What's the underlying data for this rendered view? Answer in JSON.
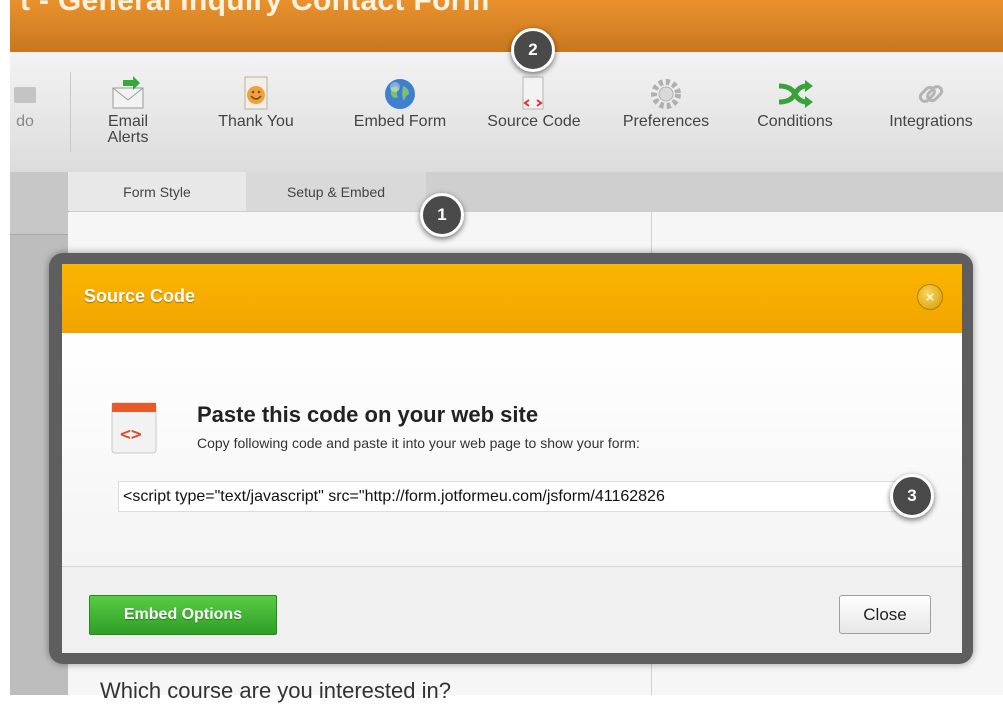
{
  "window": {
    "title": "t - General Inquiry Contact Form"
  },
  "toolbar": {
    "undo_label": "do",
    "items": [
      {
        "label": "Email",
        "label2": "Alerts",
        "icon": "envelope-icon"
      },
      {
        "label": "Thank You",
        "icon": "smiley-page-icon"
      },
      {
        "label": "Embed Form",
        "icon": "globe-icon"
      },
      {
        "label": "Source Code",
        "icon": "code-document-icon"
      },
      {
        "label": "Preferences",
        "icon": "gear-icon"
      },
      {
        "label": "Conditions",
        "icon": "shuffle-arrows-icon"
      },
      {
        "label": "Integrations",
        "icon": "chain-link-icon"
      }
    ]
  },
  "tabs": [
    {
      "label": "Form Style"
    },
    {
      "label": "Setup & Embed"
    }
  ],
  "callouts": [
    "1",
    "2",
    "3"
  ],
  "modal": {
    "title": "Source Code",
    "heading": "Paste this code on your web site",
    "subtext": "Copy following code and paste it into your web page to show your form:",
    "code_value": "<script type=\"text/javascript\" src=\"http://form.jotformeu.com/jsform/41162826",
    "embed_options_label": "Embed Options",
    "close_label": "Close"
  },
  "background": {
    "question_text": "Which course are you interested in?"
  },
  "colors": {
    "title_bar": "#d9842a",
    "modal_header": "#f7ae00",
    "embed_button": "#3fb232",
    "callout_badge": "#4a4a4a"
  }
}
